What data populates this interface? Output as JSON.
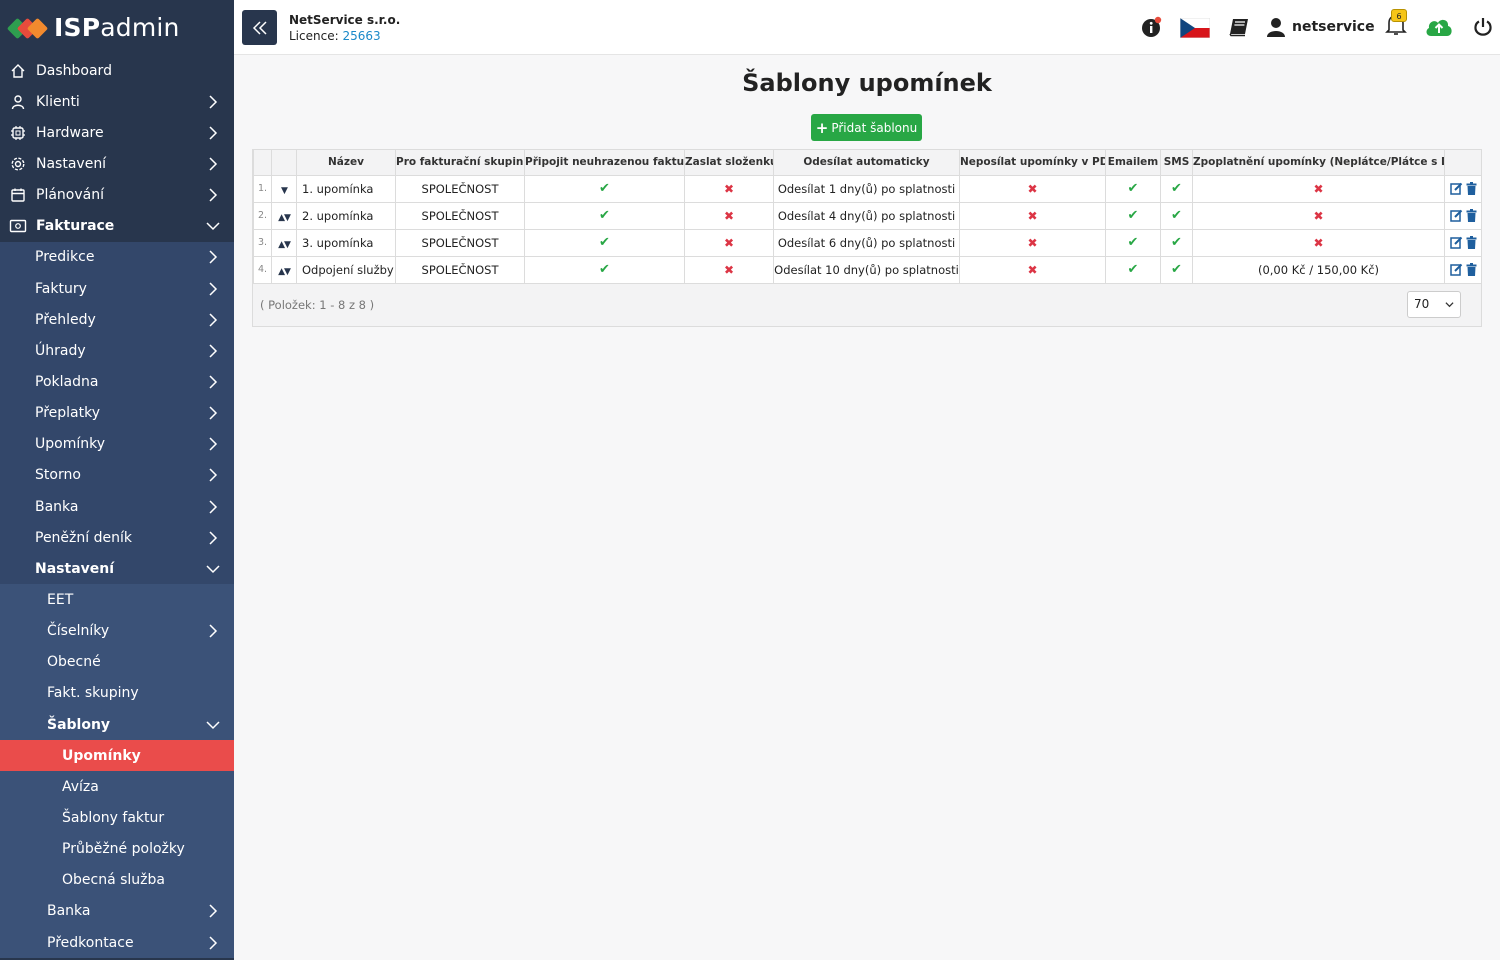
{
  "app": {
    "logo_bold": "ISP",
    "logo_rest": "admin"
  },
  "header": {
    "company": "NetService s.r.o.",
    "licence_label": "Licence:",
    "licence_number": "25663",
    "username": "netservice",
    "notification_count": "6"
  },
  "sidebar": {
    "dashboard": "Dashboard",
    "klienti": "Klienti",
    "hardware": "Hardware",
    "nastaveni": "Nastavení",
    "planovani": "Plánování",
    "fakturace": "Fakturace",
    "fakturace_items": [
      "Predikce",
      "Faktury",
      "Přehledy",
      "Úhrady",
      "Pokladna",
      "Přeplatky",
      "Upomínky",
      "Storno",
      "Banka",
      "Peněžní deník"
    ],
    "nastaveni2": "Nastavení",
    "nastaveni_items": [
      "EET",
      "Číselníky",
      "Obecné",
      "Fakt. skupiny"
    ],
    "sablony": "Šablony",
    "sablony_items": [
      "Upomínky",
      "Avíza",
      "Šablony faktur",
      "Průběžné položky",
      "Obecná služba"
    ],
    "after_items": [
      "Banka",
      "Předkontace"
    ]
  },
  "page": {
    "title": "Šablony upomínek",
    "add_button": "Přidat šablonu",
    "count_text": "( Položek: 1 - 8 z 8 )",
    "page_size": "70"
  },
  "table": {
    "headers": [
      "Název",
      "Pro fakturační skupinu",
      "Připojit neuhrazenou fakturu",
      "Zaslat složenku",
      "Odesílat automaticky",
      "Neposílat upomínky v PDF",
      "Emailem",
      "SMS",
      "Zpoplatnění upomínky (Neplátce/Plátce s DPH)"
    ],
    "rows": [
      {
        "num": "1.",
        "name": "1. upomínka",
        "group": "SPOLEČNOST",
        "auto": "Odesílat 1 dny(ů) po splatnosti",
        "fee": ""
      },
      {
        "num": "2.",
        "name": "2. upomínka",
        "group": "SPOLEČNOST",
        "auto": "Odesílat 4 dny(ů) po splatnosti",
        "fee": ""
      },
      {
        "num": "3.",
        "name": "3. upomínka",
        "group": "SPOLEČNOST",
        "auto": "Odesílat 6 dny(ů) po splatnosti",
        "fee": ""
      },
      {
        "num": "4.",
        "name": "Odpojení služby",
        "group": "SPOLEČNOST",
        "auto": "Odesílat 10 dny(ů) po splatnosti",
        "fee": "(0,00 Kč / 150,00 Kč)"
      }
    ]
  }
}
